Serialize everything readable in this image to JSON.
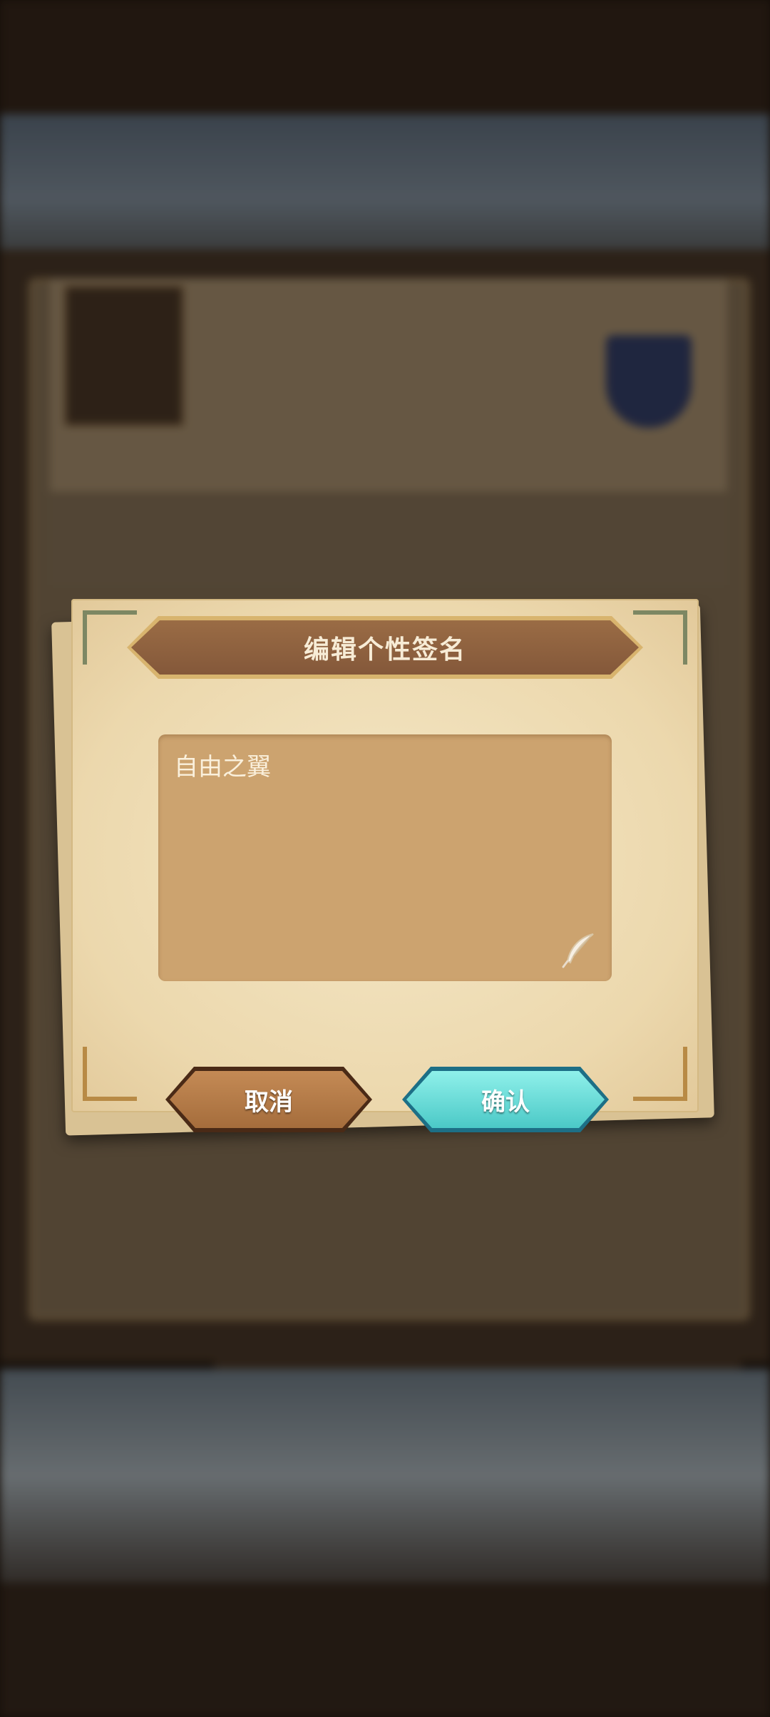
{
  "dialog": {
    "title": "编辑个性签名",
    "signature_value": "自由之翼",
    "cancel_label": "取消",
    "confirm_label": "确认"
  },
  "icons": {
    "quill": "quill-pen-icon"
  },
  "colors": {
    "banner": "#84583a",
    "input_bg": "#cca36f",
    "cancel_button": "#a56d3c",
    "confirm_button": "#4bc9c7",
    "paper": "#ecd8ad"
  }
}
